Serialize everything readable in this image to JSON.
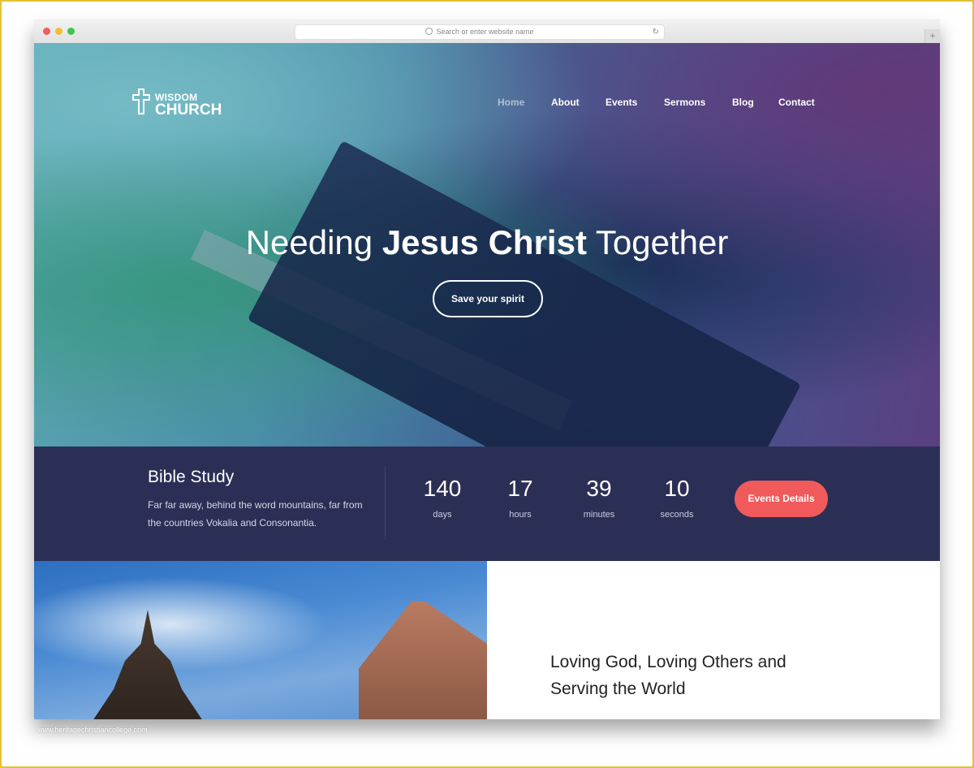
{
  "browser": {
    "url_placeholder": "Search or enter website name",
    "search_icon": "magnifier-icon",
    "reload_icon": "reload-icon",
    "new_tab_label": "+"
  },
  "site": {
    "logo": {
      "line1": "WISDOM",
      "line2": "CHURCH",
      "icon": "cross-icon"
    },
    "nav": [
      {
        "label": "Home",
        "active": true
      },
      {
        "label": "About",
        "active": false
      },
      {
        "label": "Events",
        "active": false
      },
      {
        "label": "Sermons",
        "active": false
      },
      {
        "label": "Blog",
        "active": false
      },
      {
        "label": "Contact",
        "active": false
      }
    ],
    "hero": {
      "headline_pre": "Needing",
      "headline_bold": "Jesus Christ",
      "headline_post": "Together",
      "cta_label": "Save your spirit"
    },
    "event": {
      "title": "Bible Study",
      "description": "Far far away, behind the word mountains, far from the countries Vokalia and Consonantia.",
      "countdown": [
        {
          "value": "140",
          "unit": "days"
        },
        {
          "value": "17",
          "unit": "hours"
        },
        {
          "value": "39",
          "unit": "minutes"
        },
        {
          "value": "10",
          "unit": "seconds"
        }
      ],
      "button_label": "Events Details",
      "accent": "#f15a5a",
      "band_color": "#2c2f55"
    },
    "mission": {
      "text": "Loving God, Loving Others and Serving the World"
    }
  },
  "watermark": "www.heritagechristiancollege.com"
}
